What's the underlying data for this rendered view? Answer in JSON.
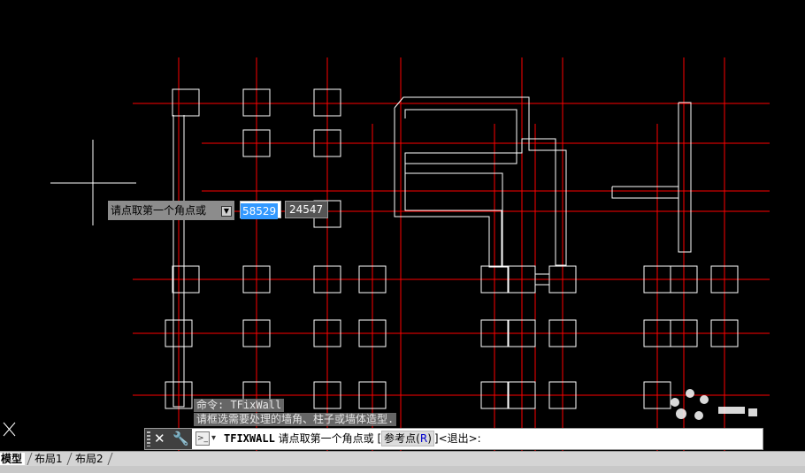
{
  "drawing": {
    "axis_color": "#ff0000",
    "entity_color": "#ffffff",
    "background_color": "#000000",
    "accent_color": "#3399ff"
  },
  "dynamic_input": {
    "prompt": "请点取第一个角点或",
    "options_icon": "dropdown-arrow-icon",
    "x_value": "58529",
    "y_value": "24547"
  },
  "command_history": {
    "line1": "命令: TFixWall",
    "line2": "请框选需要处理的墙角、柱子或墙体造型."
  },
  "command_line": {
    "command": "TFIXWALL",
    "prompt": "请点取第一个角点或",
    "open_bracket": "[",
    "option_label": "参考点(",
    "option_key": "R",
    "option_close": ")",
    "close_bracket": "]",
    "exit_text": "<退出>:"
  },
  "layout_tabs": [
    "模型",
    "布局1",
    "布局2"
  ]
}
